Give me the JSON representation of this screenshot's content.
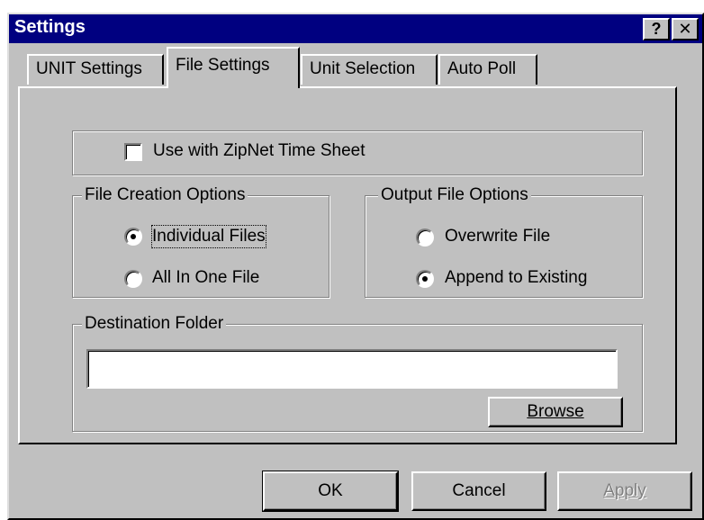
{
  "window": {
    "title": "Settings",
    "help_glyph": "?",
    "close_glyph": "✕"
  },
  "tabs": [
    {
      "label": "UNIT Settings",
      "active": false
    },
    {
      "label": "File Settings",
      "active": true
    },
    {
      "label": "Unit Selection",
      "active": false
    },
    {
      "label": "Auto Poll",
      "active": false
    }
  ],
  "zipnet": {
    "label": "Use with ZipNet Time Sheet",
    "checked": false
  },
  "file_creation": {
    "title": "File Creation Options",
    "options": [
      {
        "label": "Individual Files",
        "selected": true,
        "focused": true
      },
      {
        "label": "All In One File",
        "selected": false
      }
    ]
  },
  "output_file": {
    "title": "Output File Options",
    "options": [
      {
        "label": "Overwrite File",
        "selected": false
      },
      {
        "label": "Append to Existing",
        "selected": true
      }
    ]
  },
  "destination": {
    "title": "Destination Folder",
    "value": "",
    "browse_label": "Browse"
  },
  "buttons": {
    "ok": "OK",
    "cancel": "Cancel",
    "apply": "Apply",
    "apply_enabled": false
  },
  "colors": {
    "title_bar": "#000080",
    "face": "#c0c0c0"
  }
}
